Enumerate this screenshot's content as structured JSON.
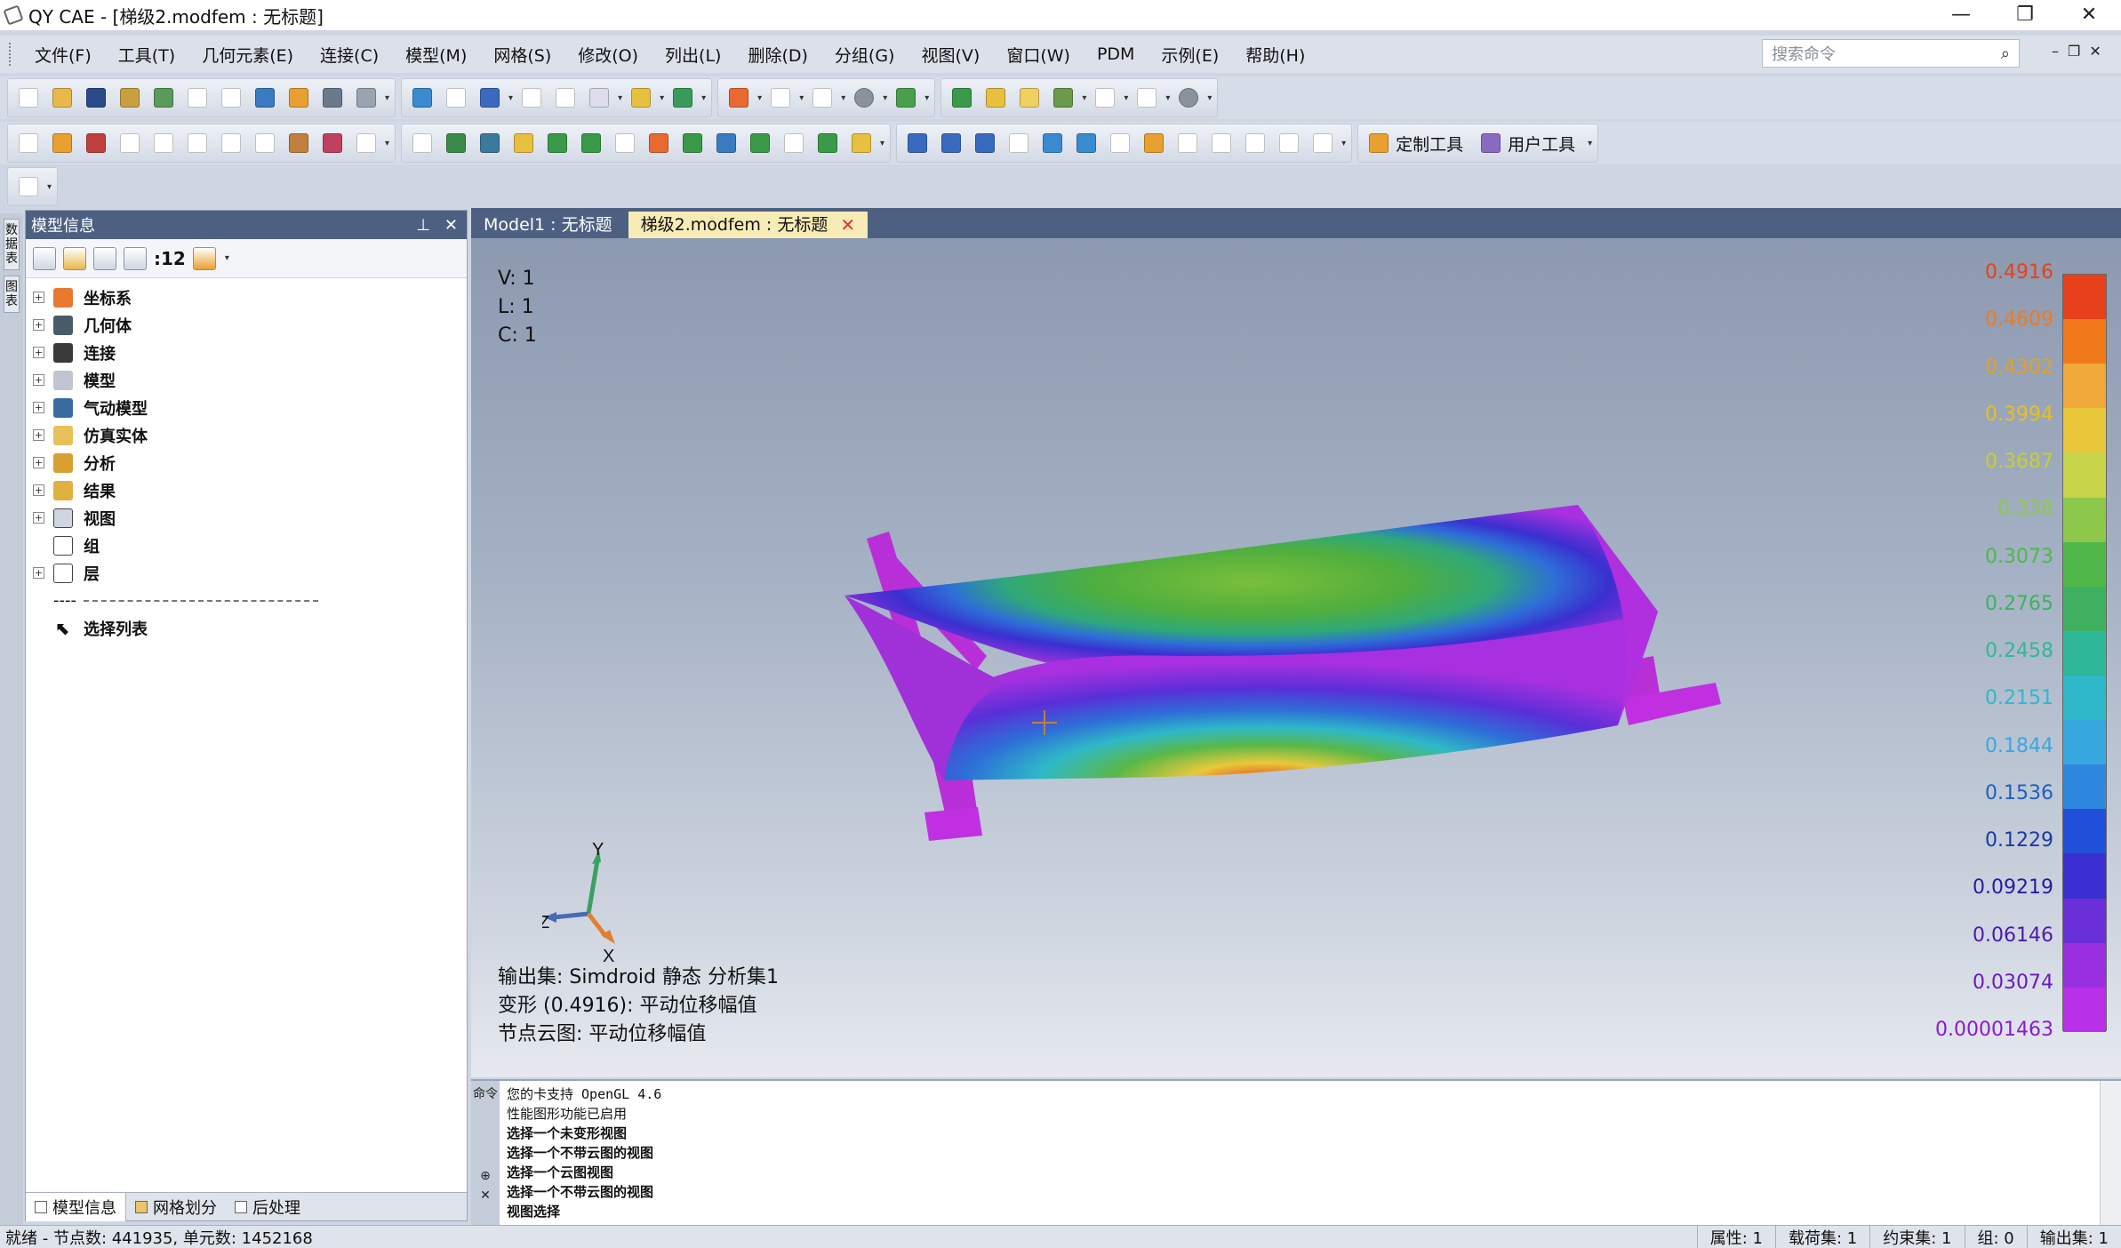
{
  "window": {
    "title": "QY CAE - [梯级2.modfem : 无标题]",
    "controls": [
      "—",
      "❐",
      "✕"
    ]
  },
  "menu": [
    "文件(F)",
    "工具(T)",
    "几何元素(E)",
    "连接(C)",
    "模型(M)",
    "网格(S)",
    "修改(O)",
    "列出(L)",
    "删除(D)",
    "分组(G)",
    "视图(V)",
    "窗口(W)",
    "PDM",
    "示例(E)",
    "帮助(H)"
  ],
  "search": {
    "placeholder": "搜索命令"
  },
  "toolbar": {
    "custom_tools": "定制工具",
    "user_tools": "用户工具"
  },
  "left_strip": [
    "数据表",
    "图表"
  ],
  "panel": {
    "title": "模型信息",
    "count": ":12",
    "tree": [
      "坐标系",
      "几何体",
      "连接",
      "模型",
      "气动模型",
      "仿真实体",
      "分析",
      "结果",
      "视图",
      "组",
      "层"
    ],
    "separator": "----",
    "select_list": "选择列表",
    "tabs": [
      "模型信息",
      "网格划分",
      "后处理"
    ]
  },
  "doc_tabs": [
    "Model1 : 无标题",
    "梯级2.modfem : 无标题"
  ],
  "viewport": {
    "vlc": [
      "V: 1",
      "L: 1",
      "C: 1"
    ],
    "axes": {
      "x": "X",
      "y": "Y",
      "z": "Z"
    },
    "info": [
      "输出集: Simdroid 静态 分析集1",
      "变形 (0.4916): 平动位移幅值",
      "节点云图: 平动位移幅值"
    ]
  },
  "legend": {
    "labels": [
      "0.4916",
      "0.4609",
      "0.4302",
      "0.3994",
      "0.3687",
      "0.338",
      "0.3073",
      "0.2765",
      "0.2458",
      "0.2151",
      "0.1844",
      "0.1536",
      "0.1229",
      "0.09219",
      "0.06146",
      "0.03074",
      "0.00001463"
    ],
    "colors": [
      "#e8401a",
      "#f07a1a",
      "#f0a83a",
      "#e8c83a",
      "#c8d44a",
      "#8ec84a",
      "#4fb848",
      "#3fb060",
      "#2fb898",
      "#2eb8c8",
      "#38a8e0",
      "#2e88e0",
      "#2050d8",
      "#3a2fd0",
      "#6a2fd8",
      "#9a2fe0",
      "#b830e8"
    ],
    "label_colors": [
      "#e8401a",
      "#f07a1a",
      "#e8a020",
      "#e8c020",
      "#c8d030",
      "#8ec84a",
      "#4fb848",
      "#3fb060",
      "#2fb898",
      "#2eb8c8",
      "#38a8e0",
      "#2060c0",
      "#1a3aa8",
      "#2a1aa0",
      "#4a1ab0",
      "#6a1ac0",
      "#8a1ad0"
    ]
  },
  "console": {
    "side": [
      "命令",
      "⊕",
      "✕"
    ],
    "lines": [
      "您的卡支持 OpenGL 4.6",
      "性能图形功能已启用",
      "选择一个未变形视图",
      "选择一个不带云图的视图",
      "选择一个云图视图",
      "选择一个不带云图的视图",
      "视图选择"
    ]
  },
  "status": {
    "left": "就绪 - 节点数: 441935, 单元数: 1452168",
    "right": [
      "属性: 1",
      "载荷集: 1",
      "约束集: 1",
      "组: 0",
      "输出集: 1"
    ]
  },
  "colors": {
    "panel_title_bg": "#4d6082",
    "doc_tab_active": "#f7ebb6",
    "mesh_magenta": "#b82fd8"
  }
}
